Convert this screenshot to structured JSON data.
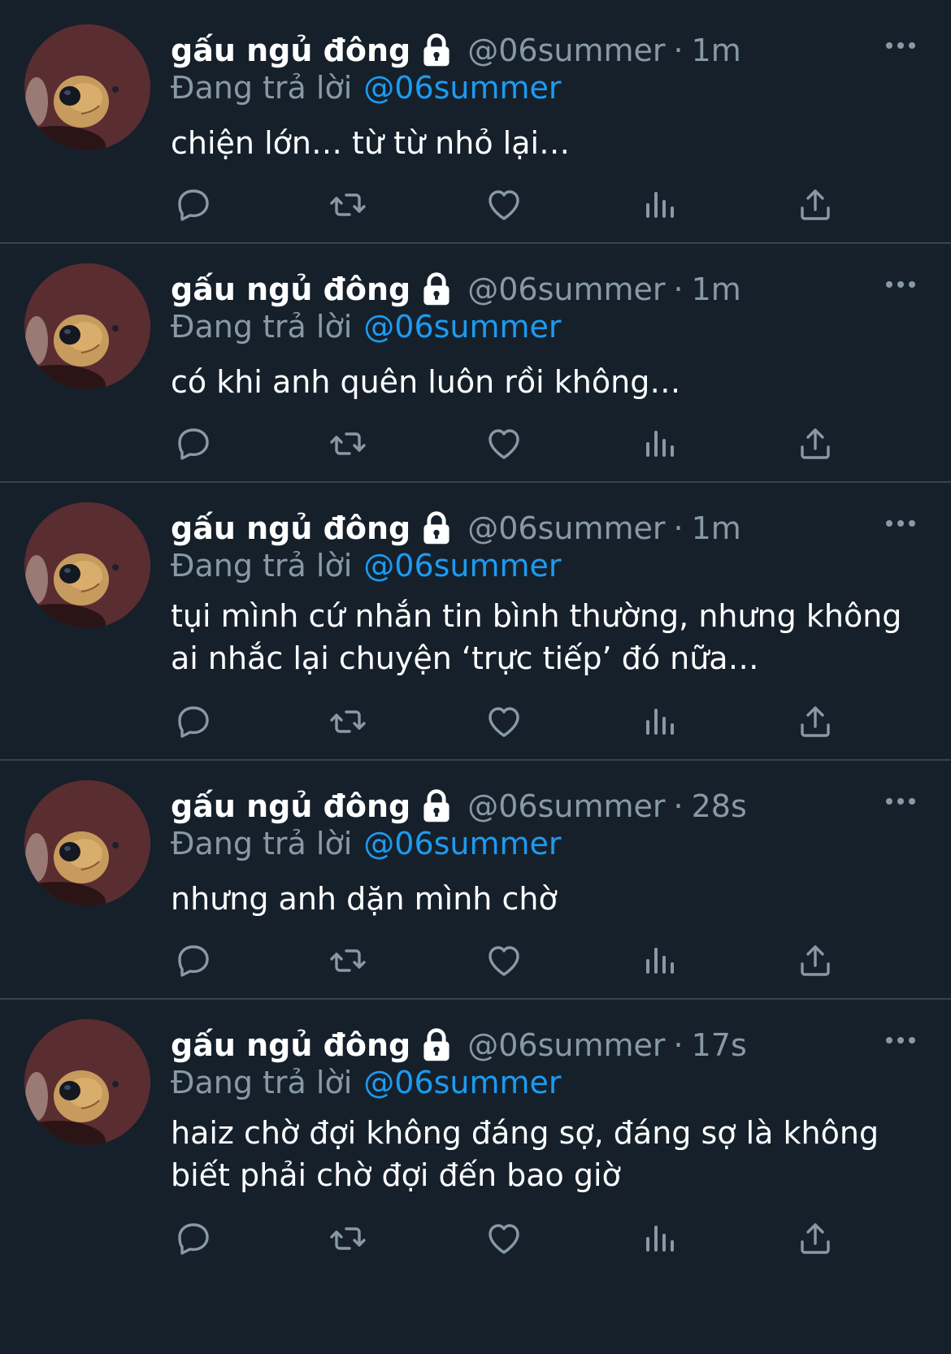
{
  "tweets": [
    {
      "display_name": "gấu ngủ đông",
      "handle": "@06summer",
      "separator": "·",
      "time": "1m",
      "reply_prefix": "Đang trả lời",
      "reply_to": "@06summer",
      "text": "chiện lớn… từ từ nhỏ lại…"
    },
    {
      "display_name": "gấu ngủ đông",
      "handle": "@06summer",
      "separator": "·",
      "time": "1m",
      "reply_prefix": "Đang trả lời",
      "reply_to": "@06summer",
      "text": "có khi anh quên luôn rồi không…"
    },
    {
      "display_name": "gấu ngủ đông",
      "handle": "@06summer",
      "separator": "·",
      "time": "1m",
      "reply_prefix": "Đang trả lời",
      "reply_to": "@06summer",
      "text": "tụi mình cứ nhắn tin bình thường, nhưng không ai nhắc lại chuyện ‘trực tiếp’ đó nữa…"
    },
    {
      "display_name": "gấu ngủ đông",
      "handle": "@06summer",
      "separator": "·",
      "time": "28s",
      "reply_prefix": "Đang trả lời",
      "reply_to": "@06summer",
      "text": "nhưng anh dặn mình chờ"
    },
    {
      "display_name": "gấu ngủ đông",
      "handle": "@06summer",
      "separator": "·",
      "time": "17s",
      "reply_prefix": "Đang trả lời",
      "reply_to": "@06summer",
      "text": "haiz chờ đợi không đáng sợ, đáng sợ là không biết phải chờ đợi đến bao giờ"
    }
  ],
  "icons": {
    "verified_lock": "lock-icon",
    "more": "more-icon",
    "reply": "reply-icon",
    "retweet": "retweet-icon",
    "like": "heart-icon",
    "views": "views-icon",
    "share": "share-icon"
  },
  "colors": {
    "background": "#15202b",
    "divider": "#38444d",
    "muted_text": "#8899a6",
    "link": "#1d9bf0",
    "primary_text": "#ffffff"
  }
}
